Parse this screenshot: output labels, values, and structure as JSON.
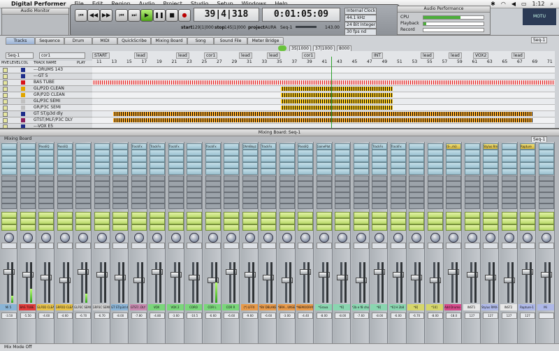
{
  "menubar": {
    "app": "Digital Performer",
    "items": [
      "File",
      "Edit",
      "Region",
      "Audio",
      "Project",
      "Studio",
      "Setup",
      "Windows",
      "Help"
    ],
    "clock": "1:12"
  },
  "audio_monitor": {
    "title": "Audio Monitor"
  },
  "transport": {
    "counter_main": "39|4|318",
    "counter_time": "0:01:05:09",
    "start_label": "start",
    "start_value": "129|1|000",
    "stop_label": "stop",
    "stop_value": "145|1|000",
    "project_label": "project",
    "project_value": "AURA",
    "seq_value": "Seq-1",
    "tempo": "143.00",
    "sync": "Internal Clock",
    "sample_rate": "44.1 kHz",
    "bit_depth": "24 Bit Integer",
    "fps": "30 fps nd"
  },
  "audio_performance": {
    "title": "Audio Performance",
    "rows": [
      "CPU",
      "Playback",
      "Record"
    ],
    "levels": [
      0.62,
      0.05,
      0.0
    ]
  },
  "logo": {
    "text": "MOTU"
  },
  "tracks_window": {
    "tabs": [
      "Tracks",
      "Sequence",
      "Drum",
      "MIDI",
      "QuickScribe",
      "Mixing Board",
      "Song",
      "Sound File",
      "Meter Bridge"
    ],
    "selected_tab": "Tracks",
    "seq_name": "Seq-1",
    "top_right_seq": "Seq-1",
    "track_selector": "cor1",
    "column_headers": [
      "MVE",
      "LEVEL",
      "COL",
      "TRACK NAME",
      "PLAY"
    ],
    "tracks": [
      {
        "name": "---DRUMS  143",
        "color": "#1d2d8a"
      },
      {
        "name": "---GT 5",
        "color": "#1d2d8a"
      },
      {
        "name": "BAS TUBE",
        "color": "#d8121a"
      },
      {
        "name": "GL/P2D CLEAN",
        "color": "#e0a500"
      },
      {
        "name": "GR/P2D CLEAN",
        "color": "#e0a500"
      },
      {
        "name": "GL/P3C SEMI",
        "color": "#c0c0c0"
      },
      {
        "name": "GR/P3C SEMI",
        "color": "#c0c0c0"
      },
      {
        "name": "GT ST/p3d dly",
        "color": "#1d2d8a"
      },
      {
        "name": "GTST/MLF/P3C DLY",
        "color": "#8a1d5a"
      },
      {
        "name": "---VOX E5",
        "color": "#1d2d8a"
      }
    ],
    "markers": [
      "START",
      "lead",
      "lead",
      "cor1",
      "lead",
      "lead",
      "cor1",
      "INT",
      "lead",
      "lead",
      "VOX2",
      "lead"
    ],
    "bar_numbers": [
      "11",
      "13",
      "15",
      "17",
      "19",
      "21",
      "23",
      "25",
      "27",
      "29",
      "31",
      "33",
      "35",
      "37",
      "39",
      "41",
      "43",
      "45",
      "47",
      "49",
      "51",
      "53",
      "55",
      "57",
      "59",
      "61",
      "63",
      "65",
      "67",
      "69",
      "71"
    ],
    "zoom_fields": [
      "35|1000",
      "37|1000",
      "8000"
    ]
  },
  "mixer": {
    "title": "Mixing Board: Seq-1",
    "label": "Mixing Board",
    "selector": "Seq-1",
    "status": "Mix Mode Off",
    "channels": [
      {
        "name": "Mi 5",
        "vol": "-3.50",
        "level": 0.18,
        "insert": "",
        "color": "#8ab4d6"
      },
      {
        "name": "BAS TUBE",
        "vol": "-5.50",
        "level": 0.35,
        "insert": "",
        "color": "#e33c3c"
      },
      {
        "name": "GLP2D CLEAN",
        "vol": "-4.60",
        "level": 0.0,
        "insert": "PassEQ",
        "color": "#e8c34a"
      },
      {
        "name": "GRP2D CLEAN",
        "vol": "-4.60",
        "level": 0.0,
        "insert": "PassEQ",
        "color": "#e8c34a"
      },
      {
        "name": "GLP3C SEMI",
        "vol": "-6.70",
        "level": 0.22,
        "insert": "",
        "color": "#cfcfcf"
      },
      {
        "name": "GRP3C SEMI",
        "vol": "-6.70",
        "level": 0.0,
        "insert": "",
        "color": "#cfcfcf"
      },
      {
        "name": "GT ST/p3d dly",
        "vol": "-8.00",
        "level": 0.0,
        "insert": "",
        "color": "#8ab4d6"
      },
      {
        "name": "GTST/..DLY",
        "vol": "-7.80",
        "level": 0.0,
        "insert": "TrackFx",
        "color": "#c98ab0"
      },
      {
        "name": "VOX",
        "vol": "-4.80",
        "level": 0.0,
        "insert": "TrackFx",
        "color": "#7ad67a"
      },
      {
        "name": "VOX 2",
        "vol": "-3.60",
        "level": 0.0,
        "insert": "TrackFx",
        "color": "#7ad67a"
      },
      {
        "name": "CORO",
        "vol": "-10.5",
        "level": 0.0,
        "insert": "",
        "color": "#7ad67a"
      },
      {
        "name": "COR L",
        "vol": "-6.60",
        "level": 0.5,
        "insert": "TrackFx",
        "color": "#7ad67a"
      },
      {
        "name": "COR R",
        "vol": "-6.60",
        "level": 0.0,
        "insert": "",
        "color": "#7ad67a"
      },
      {
        "name": "(*) LFFX",
        "vol": "-9.60",
        "level": 0.0,
        "insert": "OhmBoyz",
        "color": "#e89a4a"
      },
      {
        "name": "*BV DBLAKE",
        "vol": "-6.60",
        "level": 0.0,
        "insert": "TrackFx",
        "color": "#e89a4a"
      },
      {
        "name": "*BRA...UNSEL",
        "vol": "-3.00",
        "level": 0.0,
        "insert": "",
        "color": "#e89a4a"
      },
      {
        "name": "*NEMOORAMP",
        "vol": "-4.40",
        "level": 0.0,
        "insert": "PassEQ",
        "color": "#e89a4a"
      },
      {
        "name": "*Grava",
        "vol": "-8.00",
        "level": 0.0,
        "insert": "GainePlat",
        "color": "#8ad6b0"
      },
      {
        "name": "*6]",
        "vol": "-8.00",
        "level": 0.0,
        "insert": "",
        "color": "#8ad6b0"
      },
      {
        "name": "*2b e f8 chor",
        "vol": "-7.60",
        "level": 0.0,
        "insert": "",
        "color": "#8ad6b0"
      },
      {
        "name": "*8]",
        "vol": "-8.00",
        "level": 0.0,
        "insert": "TrackFx",
        "color": "#8ad6b0"
      },
      {
        "name": "*6] H 2b8",
        "vol": "-6.00",
        "level": 0.0,
        "insert": "TrackFx",
        "color": "#8ad6b0"
      },
      {
        "name": "*8]",
        "vol": "-6.70",
        "level": 0.0,
        "insert": "",
        "color": "#d6d66a"
      },
      {
        "name": "*10]",
        "vol": "-8.00",
        "level": 0.0,
        "insert": "",
        "color": "#d6d66a"
      },
      {
        "name": "Add Drums-1",
        "vol": "-18.0",
        "level": 0.0,
        "insert": "(S-..mi)",
        "color": "#d64a8a"
      },
      {
        "name": "INST1",
        "vol": "127",
        "level": 0.0,
        "insert": "",
        "color": "#e8e8e8"
      },
      {
        "name": "Stylus RMX-1",
        "vol": "127",
        "level": 0.0,
        "insert": "Stylus Rm",
        "color": "#aeb8e8"
      },
      {
        "name": "INST2",
        "vol": "127",
        "level": 0.0,
        "insert": "",
        "color": "#e8e8e8"
      },
      {
        "name": "Rapture-1",
        "vol": "127",
        "level": 0.0,
        "insert": "Rapture",
        "color": "#aeb8e8"
      },
      {
        "name": "Mi",
        "vol": "",
        "level": 0.0,
        "insert": "",
        "color": "#aeb8e8"
      }
    ]
  }
}
